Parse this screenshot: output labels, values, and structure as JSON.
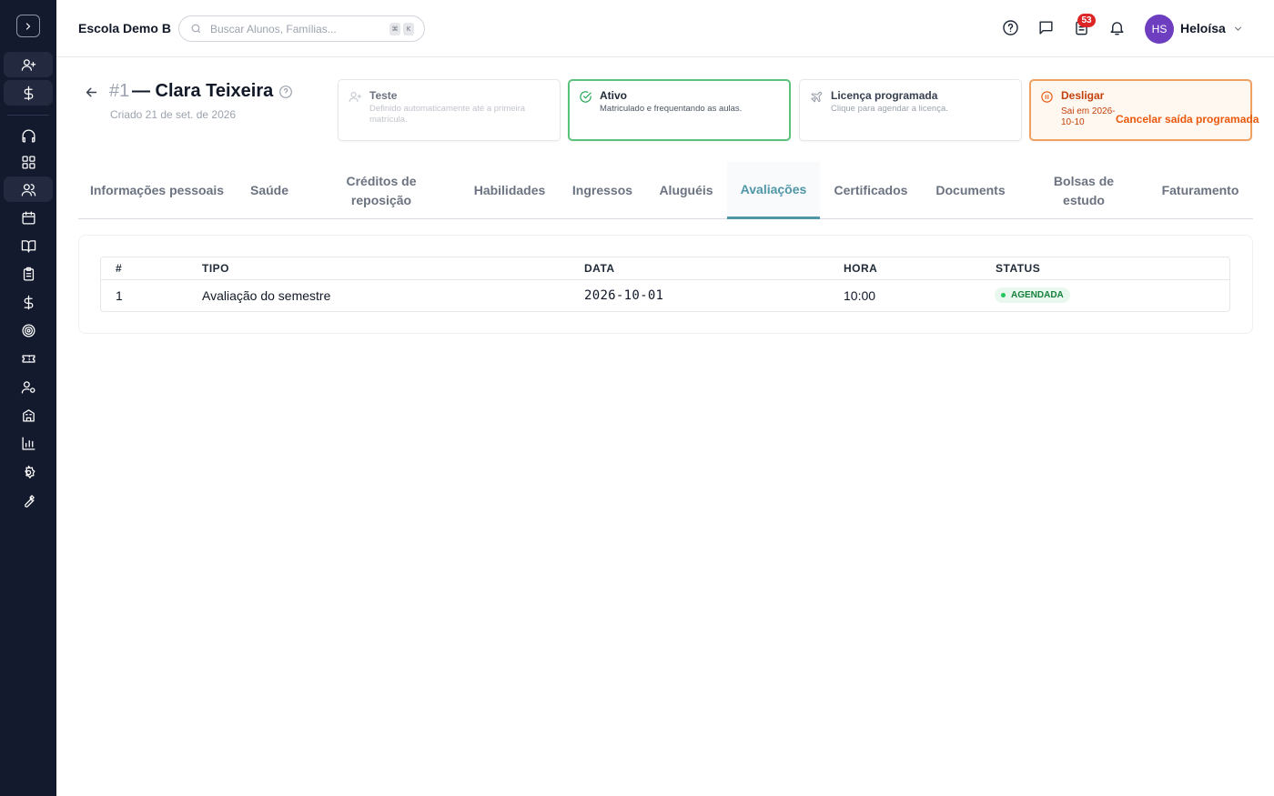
{
  "header": {
    "school_name": "Escola Demo B",
    "search_placeholder": "Buscar Alunos, Famílias...",
    "search_shortcut": [
      "⌘",
      "K"
    ],
    "notification_count": "53",
    "user_initials": "HS",
    "user_name": "Heloísa"
  },
  "student": {
    "id": "#1",
    "name": "— Clara Teixeira",
    "created": "Criado 21 de set. de 2026"
  },
  "status_cards": {
    "trial": {
      "title": "Teste",
      "desc": "Definido automaticamente até a primeira matrícula."
    },
    "active": {
      "title": "Ativo",
      "desc": "Matriculado e frequentando as aulas."
    },
    "leave": {
      "title": "Licença programada",
      "desc": "Clique para agendar a licença."
    },
    "drop": {
      "title": "Desligar",
      "desc": "Sai em 2026-10-10",
      "action": "Cancelar saída programada"
    }
  },
  "tabs": [
    "Informações pessoais",
    "Saúde",
    "Créditos de reposição",
    "Habilidades",
    "Ingressos",
    "Aluguéis",
    "Avaliações",
    "Certificados",
    "Documents",
    "Bolsas de estudo",
    "Faturamento"
  ],
  "active_tab": "Avaliações",
  "table": {
    "columns": [
      "#",
      "TIPO",
      "DATA",
      "HORA",
      "STATUS"
    ],
    "rows": [
      {
        "num": "1",
        "type": "Avaliação do semestre",
        "date": "2026-10-01",
        "time": "10:00",
        "status": "AGENDADA"
      }
    ]
  },
  "colors": {
    "sidebar_bg": "#141a2e",
    "accent": "#4f97a8",
    "active_green": "#5ac27a",
    "drop_orange": "#ea580c",
    "avatar": "#6d3fc0",
    "badge_red": "#dc2626"
  }
}
